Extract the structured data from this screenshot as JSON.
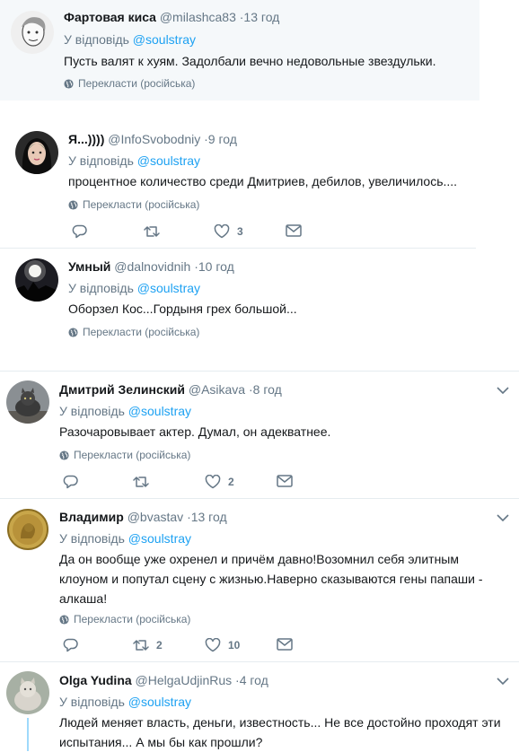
{
  "translate_label": "Перекласти (російська)",
  "tweets": [
    {
      "name": "Фартовая киса",
      "handle": "@milashca83",
      "time": "·13 год",
      "reply_prefix": "У відповідь",
      "reply_to": "@soulstray",
      "text": "Пусть валят к хуям. Задолбали вечно недовольные звездульки."
    },
    {
      "name": "Я...))))",
      "handle": "@InfoSvobodniy",
      "time": "·9 год",
      "reply_prefix": "У відповідь",
      "reply_to": "@soulstray",
      "text": "процентное количество среди Дмитриев, дебилов, увеличилось....",
      "likes": "3"
    },
    {
      "name": "Умный",
      "handle": "@dalnovidnih",
      "time": "·10 год",
      "reply_prefix": "У відповідь",
      "reply_to": "@soulstray",
      "text": "Оборзел Кос...Гордыня грех большой..."
    },
    {
      "name": "Дмитрий Зелинский",
      "handle": "@Asikava",
      "time": "·8 год",
      "reply_prefix": "У відповідь",
      "reply_to": "@soulstray",
      "text": "Разочаровывает актер. Думал, он адекватнее.",
      "likes": "2"
    },
    {
      "name": "Владимир",
      "handle": "@bvastav",
      "time": "·13 год",
      "reply_prefix": "У відповідь",
      "reply_to": "@soulstray",
      "text": "Да он вообще уже охренел и причём давно!Возомнил себя элитным клоуном и попутал сцену с жизнью.Наверно сказываются гены папаши - алкаша!",
      "retweets": "2",
      "likes": "10"
    },
    {
      "name": "Olga Yudina",
      "handle": "@HelgaUdjinRus",
      "time": "·4 год",
      "reply_prefix": "У відповідь",
      "reply_to": "@soulstray",
      "text": "Людей меняет власть, деньги, известность... Не все достойно проходят эти испытания... А мы бы как прошли?"
    }
  ],
  "colors": {
    "link": "#1da1f2",
    "muted": "#657786",
    "highlight_bg": "#f5f8fa",
    "divider": "#e6ecf0",
    "thread_line": "#9fd9fb"
  }
}
